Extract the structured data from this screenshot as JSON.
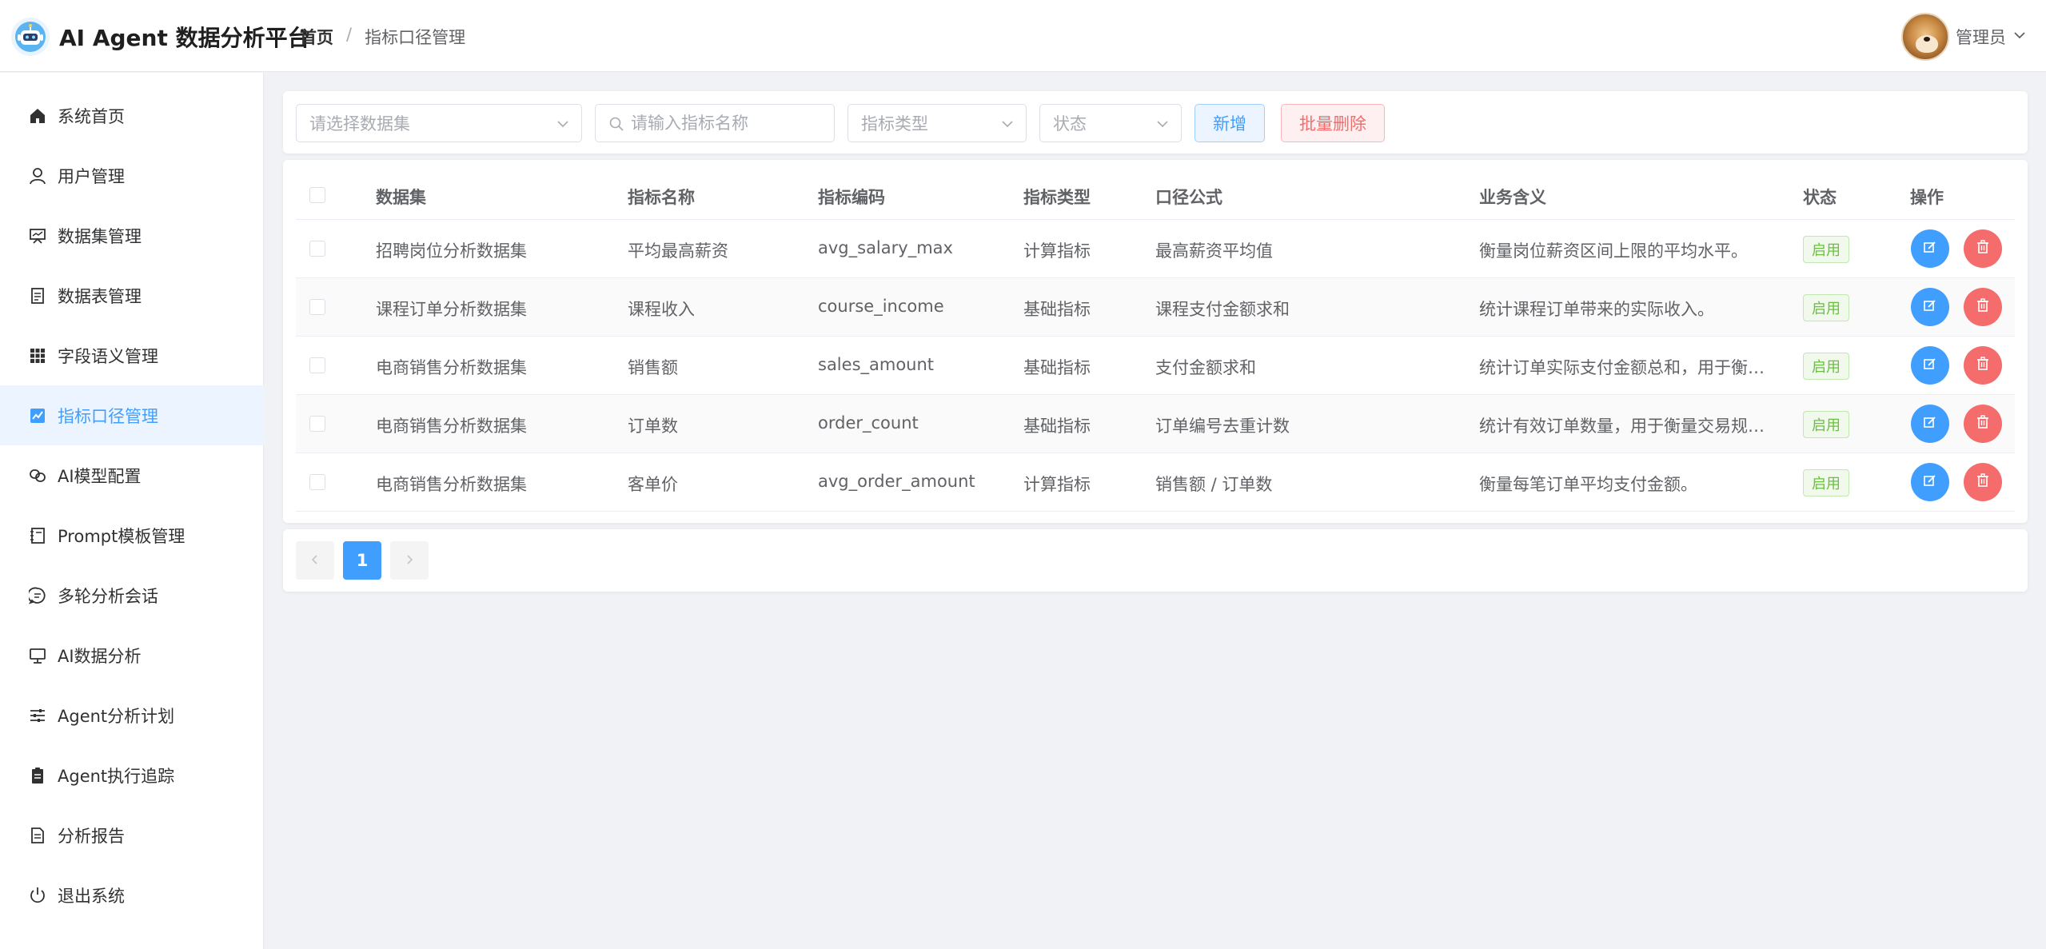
{
  "header": {
    "app_title": "AI Agent 数据分析平台",
    "breadcrumb": {
      "home": "首页",
      "separator": "/",
      "current": "指标口径管理"
    },
    "user": {
      "name": "管理员"
    }
  },
  "sidebar": {
    "active_index": 5,
    "items": [
      {
        "label": "系统首页",
        "icon": "home-icon"
      },
      {
        "label": "用户管理",
        "icon": "user-icon"
      },
      {
        "label": "数据集管理",
        "icon": "presentation-icon"
      },
      {
        "label": "数据表管理",
        "icon": "document-icon"
      },
      {
        "label": "字段语义管理",
        "icon": "grid-icon"
      },
      {
        "label": "指标口径管理",
        "icon": "trend-chart-icon"
      },
      {
        "label": "AI模型配置",
        "icon": "connection-icon"
      },
      {
        "label": "Prompt模板管理",
        "icon": "notebook-icon"
      },
      {
        "label": "多轮分析会话",
        "icon": "chat-icon"
      },
      {
        "label": "AI数据分析",
        "icon": "monitor-icon"
      },
      {
        "label": "Agent分析计划",
        "icon": "sliders-icon"
      },
      {
        "label": "Agent执行追踪",
        "icon": "clipboard-icon"
      },
      {
        "label": "分析报告",
        "icon": "report-icon"
      },
      {
        "label": "退出系统",
        "icon": "power-icon"
      }
    ]
  },
  "toolbar": {
    "dataset_placeholder": "请选择数据集",
    "search_placeholder": "请输入指标名称",
    "type_placeholder": "指标类型",
    "status_placeholder": "状态",
    "add_label": "新增",
    "batch_delete_label": "批量删除"
  },
  "table": {
    "columns": [
      "数据集",
      "指标名称",
      "指标编码",
      "指标类型",
      "口径公式",
      "业务含义",
      "状态",
      "操作"
    ],
    "rows": [
      {
        "dataset": "招聘岗位分析数据集",
        "name": "平均最高薪资",
        "code": "avg_salary_max",
        "type": "计算指标",
        "formula": "最高薪资平均值",
        "meaning": "衡量岗位薪资区间上限的平均水平。",
        "status": "启用"
      },
      {
        "dataset": "课程订单分析数据集",
        "name": "课程收入",
        "code": "course_income",
        "type": "基础指标",
        "formula": "课程支付金额求和",
        "meaning": "统计课程订单带来的实际收入。",
        "status": "启用"
      },
      {
        "dataset": "电商销售分析数据集",
        "name": "销售额",
        "code": "sales_amount",
        "type": "基础指标",
        "formula": "支付金额求和",
        "meaning": "统计订单实际支付金额总和，用于衡…",
        "status": "启用"
      },
      {
        "dataset": "电商销售分析数据集",
        "name": "订单数",
        "code": "order_count",
        "type": "基础指标",
        "formula": "订单编号去重计数",
        "meaning": "统计有效订单数量，用于衡量交易规…",
        "status": "启用"
      },
      {
        "dataset": "电商销售分析数据集",
        "name": "客单价",
        "code": "avg_order_amount",
        "type": "计算指标",
        "formula": "销售额 / 订单数",
        "meaning": "衡量每笔订单平均支付金额。",
        "status": "启用"
      }
    ]
  },
  "pagination": {
    "current": "1"
  },
  "colors": {
    "primary": "#409eff",
    "danger": "#f56c6c",
    "success": "#67c23a"
  }
}
